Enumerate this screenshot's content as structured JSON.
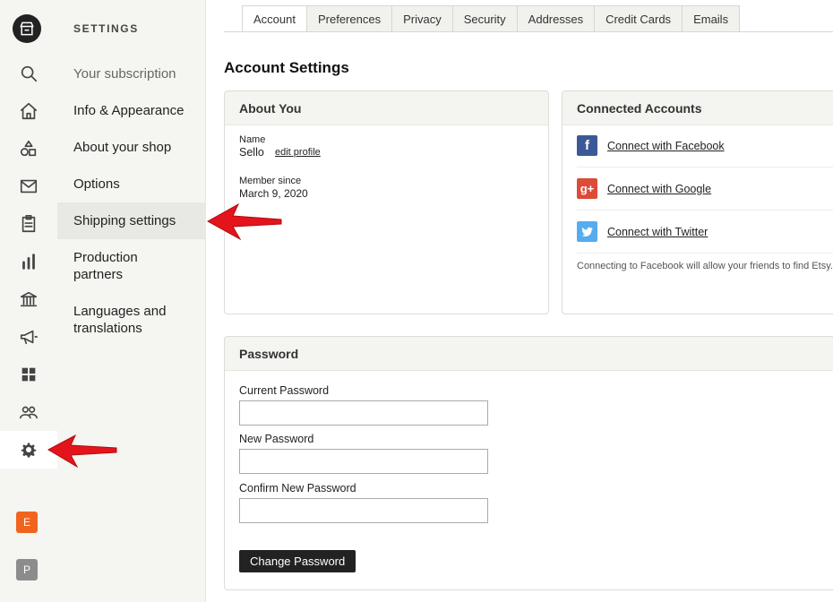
{
  "rail": {
    "accounts": [
      {
        "letter": "E",
        "color": "#f1641e"
      },
      {
        "letter": "P",
        "color": "#8c8c8c"
      }
    ]
  },
  "subnav": {
    "title": "SETTINGS",
    "items": [
      {
        "label": "Your subscription"
      },
      {
        "label": "Info & Appearance"
      },
      {
        "label": "About your shop"
      },
      {
        "label": "Options"
      },
      {
        "label": "Shipping settings"
      },
      {
        "label": "Production partners"
      },
      {
        "label": "Languages and translations"
      }
    ]
  },
  "tabs": [
    "Account",
    "Preferences",
    "Privacy",
    "Security",
    "Addresses",
    "Credit Cards",
    "Emails"
  ],
  "page_title": "Account Settings",
  "about": {
    "title": "About You",
    "name_label": "Name",
    "name_value": "Sello",
    "edit_link": "edit profile",
    "member_label": "Member since",
    "member_value": "March 9, 2020"
  },
  "connected": {
    "title": "Connected Accounts",
    "facebook": "Connect with Facebook",
    "google": "Connect with Google",
    "twitter": "Connect with Twitter",
    "note": "Connecting to Facebook will allow your friends to find Etsy."
  },
  "password": {
    "title": "Password",
    "current_label": "Current Password",
    "new_label": "New Password",
    "confirm_label": "Confirm New Password",
    "button": "Change Password"
  },
  "colors": {
    "facebook": "#3b5998",
    "google": "#dd4b39",
    "twitter": "#55acee",
    "arrow": "#e3141b"
  }
}
